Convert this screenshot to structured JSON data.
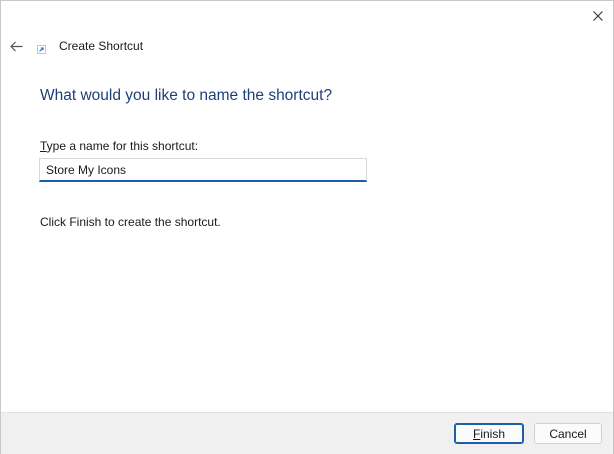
{
  "window": {
    "title": "Create Shortcut"
  },
  "wizard": {
    "heading": "What would you like to name the shortcut?",
    "name_label_first": "T",
    "name_label_rest": "ype a name for this shortcut:",
    "name_value": "Store My Icons",
    "instruction": "Click Finish to create the shortcut."
  },
  "footer": {
    "finish_label_first": "F",
    "finish_label_rest": "inish",
    "cancel_label": "Cancel"
  },
  "icons": {
    "close": "close-icon",
    "back": "back-arrow-icon",
    "shortcut": "shortcut-icon"
  },
  "colors": {
    "heading": "#1e3f7a",
    "accent": "#1a5fa8",
    "footer_bg": "#f0f0f0"
  }
}
